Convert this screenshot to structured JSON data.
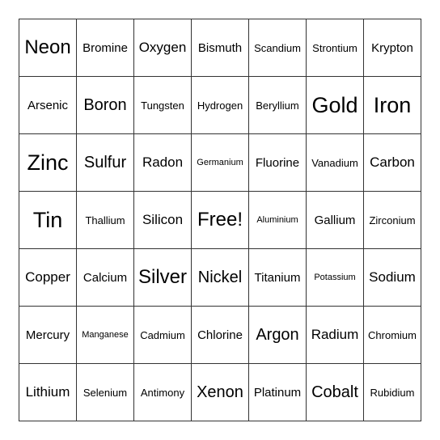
{
  "board": {
    "rows": [
      [
        {
          "text": "Neon",
          "size": "s24"
        },
        {
          "text": "Bromine",
          "size": "s15"
        },
        {
          "text": "Oxygen",
          "size": "s17"
        },
        {
          "text": "Bismuth",
          "size": "s15"
        },
        {
          "text": "Scandium",
          "size": "s13"
        },
        {
          "text": "Strontium",
          "size": "s13"
        },
        {
          "text": "Krypton",
          "size": "s15"
        }
      ],
      [
        {
          "text": "Arsenic",
          "size": "s15"
        },
        {
          "text": "Boron",
          "size": "s20"
        },
        {
          "text": "Tungsten",
          "size": "s13"
        },
        {
          "text": "Hydrogen",
          "size": "s13"
        },
        {
          "text": "Beryllium",
          "size": "s13"
        },
        {
          "text": "Gold",
          "size": "s27"
        },
        {
          "text": "Iron",
          "size": "s27"
        }
      ],
      [
        {
          "text": "Zinc",
          "size": "s27"
        },
        {
          "text": "Sulfur",
          "size": "s20"
        },
        {
          "text": "Radon",
          "size": "s17"
        },
        {
          "text": "Germanium",
          "size": "s11"
        },
        {
          "text": "Fluorine",
          "size": "s15"
        },
        {
          "text": "Vanadium",
          "size": "s13"
        },
        {
          "text": "Carbon",
          "size": "s17"
        }
      ],
      [
        {
          "text": "Tin",
          "size": "s27"
        },
        {
          "text": "Thallium",
          "size": "s13"
        },
        {
          "text": "Silicon",
          "size": "s17"
        },
        {
          "text": "Free!",
          "size": "s24"
        },
        {
          "text": "Aluminium",
          "size": "s11"
        },
        {
          "text": "Gallium",
          "size": "s15"
        },
        {
          "text": "Zirconium",
          "size": "s13"
        }
      ],
      [
        {
          "text": "Copper",
          "size": "s17"
        },
        {
          "text": "Calcium",
          "size": "s15"
        },
        {
          "text": "Silver",
          "size": "s24"
        },
        {
          "text": "Nickel",
          "size": "s20"
        },
        {
          "text": "Titanium",
          "size": "s15"
        },
        {
          "text": "Potassium",
          "size": "s11"
        },
        {
          "text": "Sodium",
          "size": "s17"
        }
      ],
      [
        {
          "text": "Mercury",
          "size": "s15"
        },
        {
          "text": "Manganese",
          "size": "s11"
        },
        {
          "text": "Cadmium",
          "size": "s13"
        },
        {
          "text": "Chlorine",
          "size": "s15"
        },
        {
          "text": "Argon",
          "size": "s20"
        },
        {
          "text": "Radium",
          "size": "s17"
        },
        {
          "text": "Chromium",
          "size": "s13"
        }
      ],
      [
        {
          "text": "Lithium",
          "size": "s17"
        },
        {
          "text": "Selenium",
          "size": "s13"
        },
        {
          "text": "Antimony",
          "size": "s13"
        },
        {
          "text": "Xenon",
          "size": "s20"
        },
        {
          "text": "Platinum",
          "size": "s15"
        },
        {
          "text": "Cobalt",
          "size": "s20"
        },
        {
          "text": "Rubidium",
          "size": "s13"
        }
      ]
    ]
  }
}
